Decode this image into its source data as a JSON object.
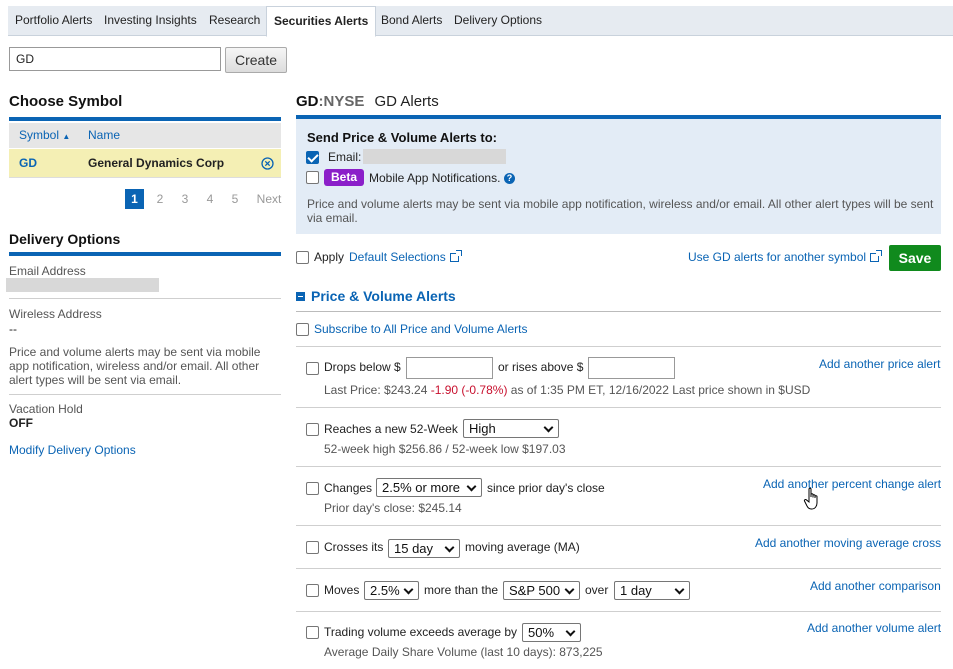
{
  "tabs": [
    {
      "label": "Portfolio Alerts"
    },
    {
      "label": "Investing Insights"
    },
    {
      "label": "Research"
    },
    {
      "label": "Securities Alerts",
      "active": true
    },
    {
      "label": "Bond Alerts"
    },
    {
      "label": "Delivery Options"
    }
  ],
  "search": {
    "value": "GD",
    "create_label": "Create"
  },
  "choose_symbol": {
    "title": "Choose Symbol",
    "col_symbol": "Symbol",
    "col_name": "Name",
    "row": {
      "symbol": "GD",
      "name": "General Dynamics Corp"
    },
    "pager": [
      "1",
      "2",
      "3",
      "4",
      "5",
      "Next"
    ]
  },
  "delivery": {
    "title": "Delivery Options",
    "email_label": "Email Address",
    "wireless_label": "Wireless Address",
    "wireless_value": "--",
    "note": "Price and volume alerts may be sent via mobile app notification, wireless and/or email. All other alert types will be sent via email.",
    "vacation_label": "Vacation Hold",
    "vacation_value": "OFF",
    "modify_link": "Modify Delivery Options"
  },
  "header": {
    "symbol": "GD",
    "exchange": ":NYSE",
    "title": "GD Alerts"
  },
  "send": {
    "title": "Send Price & Volume Alerts to:",
    "email_label": "Email:",
    "beta": "Beta",
    "mobile_label": "Mobile App Notifications.",
    "note": "Price and volume alerts may be sent via mobile app notification, wireless and/or email. All other alert types will be sent via email."
  },
  "actions": {
    "apply": "Apply",
    "default_selections": "Default Selections",
    "use_for_other": "Use GD alerts for another symbol",
    "save": "Save"
  },
  "pv": {
    "section_title": "Price & Volume Alerts",
    "subscribe_all": "Subscribe to All Price and Volume Alerts",
    "drops": {
      "label": "Drops below $",
      "or_rises": "or rises above $",
      "link": "Add another price alert",
      "last_price_prefix": "Last Price: $243.24",
      "change": "-1.90 (-0.78%)",
      "last_price_suffix": "as of 1:35 PM ET, 12/16/2022 Last price shown in $USD"
    },
    "high52": {
      "label": "Reaches a new 52-Week",
      "select": "High",
      "sub": "52-week high $256.86 / 52-week low $197.03"
    },
    "changes": {
      "label": "Changes",
      "select": "2.5% or more",
      "suffix": "since prior day's close",
      "sub": "Prior day's close: $245.14",
      "link": "Add another percent change alert"
    },
    "crosses": {
      "label": "Crosses its",
      "select": "15 day",
      "suffix": "moving average (MA)",
      "link": "Add another moving average cross"
    },
    "moves": {
      "label": "Moves",
      "select_pct": "2.5%",
      "more_than": "more than the",
      "select_index": "S&P 500",
      "over": "over",
      "select_period": "1 day",
      "link": "Add another comparison"
    },
    "volume": {
      "label": "Trading volume exceeds average by",
      "select": "50%",
      "sub": "Average Daily Share Volume (last 10 days): 873,225",
      "link": "Add another volume alert"
    }
  }
}
